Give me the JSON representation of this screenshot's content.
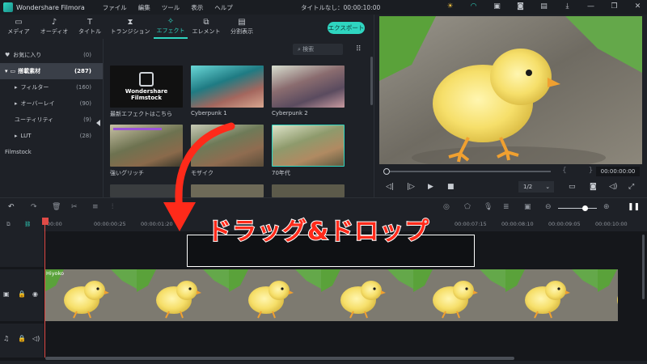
{
  "titlebar": {
    "app_name": "Wondershare Filmora",
    "menu": [
      "ファイル",
      "編集",
      "ツール",
      "表示",
      "ヘルプ"
    ],
    "document_title": "タイトルなし：00:00:10:00"
  },
  "toolbar": {
    "tabs": [
      {
        "label": "メディア",
        "icon": "folder-icon"
      },
      {
        "label": "オーディオ",
        "icon": "music-note-icon"
      },
      {
        "label": "タイトル",
        "icon": "text-icon"
      },
      {
        "label": "トランジション",
        "icon": "transition-icon"
      },
      {
        "label": "エフェクト",
        "icon": "sparkle-icon",
        "active": true
      },
      {
        "label": "エレメント",
        "icon": "element-icon"
      },
      {
        "label": "分割表示",
        "icon": "split-screen-icon"
      }
    ],
    "export_label": "エクスポート"
  },
  "sidebar": {
    "items": [
      {
        "label": "お気に入り",
        "count": "(0)",
        "icon": "heart-icon"
      },
      {
        "label": "搭載素材",
        "count": "(287)",
        "icon": "folder-icon",
        "selected": true
      },
      {
        "label": "フィルター",
        "count": "(160)"
      },
      {
        "label": "オーバーレイ",
        "count": "(90)"
      },
      {
        "label": "ユーティリティ",
        "count": "(9)"
      },
      {
        "label": "LUT",
        "count": "(28)"
      },
      {
        "label": "Filmstock",
        "count": ""
      }
    ]
  },
  "browser": {
    "search_placeholder": "検索",
    "thumbnails": [
      {
        "label": "最新エフェクトはこちら",
        "brand_line1": "Wondershare",
        "brand_line2": "Filmstock"
      },
      {
        "label": "Cyberpunk 1"
      },
      {
        "label": "Cyberpunk 2"
      },
      {
        "label": "強いグリッチ"
      },
      {
        "label": "モザイク"
      },
      {
        "label": "70年代"
      }
    ]
  },
  "preview": {
    "timecode": "00:00:00:00",
    "ratio": "1/2",
    "progress": 0.0
  },
  "timeline": {
    "ruler_ticks": [
      "00:00",
      "00:00:00:25",
      "00:00:01:20",
      "00:00:07:15",
      "00:00:08:10",
      "00:00:09:05",
      "00:00:10:00"
    ],
    "clip_label": "Hiyoko",
    "zoom_level": 0.6
  },
  "overlay": {
    "instruction": "ドラッグ&ドロップ"
  },
  "colors": {
    "accent": "#2fd5c0",
    "playhead": "#e04b47",
    "annotation": "#ff2a1a"
  }
}
